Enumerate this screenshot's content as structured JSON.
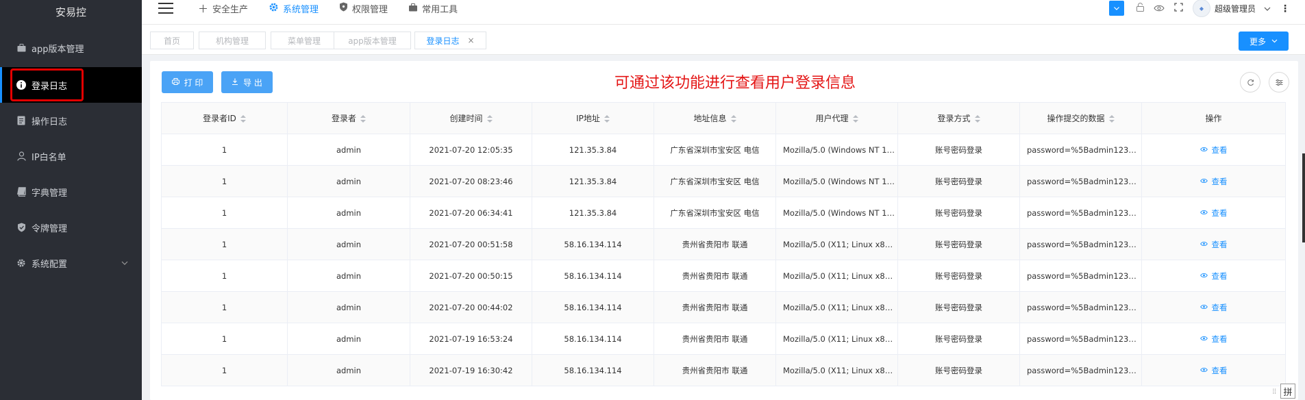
{
  "app": {
    "brand": "安易控"
  },
  "sidebar": {
    "items": [
      {
        "label": "app版本管理",
        "icon": "briefcase-icon"
      },
      {
        "label": "登录日志",
        "icon": "info-icon",
        "active": true
      },
      {
        "label": "操作日志",
        "icon": "document-icon"
      },
      {
        "label": "IP白名单",
        "icon": "user-icon"
      },
      {
        "label": "字典管理",
        "icon": "book-icon"
      },
      {
        "label": "令牌管理",
        "icon": "shield-icon"
      },
      {
        "label": "系统配置",
        "icon": "gear-icon",
        "expandable": true
      }
    ]
  },
  "header": {
    "nav": [
      {
        "label": "安全生产",
        "icon": "plus-icon"
      },
      {
        "label": "系统管理",
        "icon": "gear-icon",
        "active": true
      },
      {
        "label": "权限管理",
        "icon": "shield-icon"
      },
      {
        "label": "常用工具",
        "icon": "briefcase-icon"
      }
    ],
    "user_name": "超级管理员"
  },
  "tabs": [
    {
      "label": "首页"
    },
    {
      "label": "机构管理"
    },
    {
      "label": "菜单管理"
    },
    {
      "label": "app版本管理"
    },
    {
      "label": "登录日志",
      "active": true
    }
  ],
  "more_button": "更多",
  "toolbar": {
    "print": "打 印",
    "export": "导 出"
  },
  "notice": "可通过该功能进行查看用户登录信息",
  "table": {
    "columns": [
      "登录者ID",
      "登录者",
      "创建时间",
      "IP地址",
      "地址信息",
      "用户代理",
      "登录方式",
      "操作提交的数据",
      "操作"
    ],
    "rows": [
      [
        "1",
        "admin",
        "2021-07-20 12:05:35",
        "121.35.3.84",
        "广东省深圳市宝安区 电信",
        "Mozilla/5.0 (Windows NT 10....",
        "账号密码登录",
        "password=%5Badmin123%5..."
      ],
      [
        "1",
        "admin",
        "2021-07-20 08:23:46",
        "121.35.3.84",
        "广东省深圳市宝安区 电信",
        "Mozilla/5.0 (Windows NT 10....",
        "账号密码登录",
        "password=%5Badmin123%5..."
      ],
      [
        "1",
        "admin",
        "2021-07-20 06:34:41",
        "121.35.3.84",
        "广东省深圳市宝安区 电信",
        "Mozilla/5.0 (Windows NT 10....",
        "账号密码登录",
        "password=%5Badmin123%5..."
      ],
      [
        "1",
        "admin",
        "2021-07-20 00:51:58",
        "58.16.134.114",
        "贵州省贵阳市 联通",
        "Mozilla/5.0 (X11; Linux x86_...",
        "账号密码登录",
        "password=%5Badmin123%5..."
      ],
      [
        "1",
        "admin",
        "2021-07-20 00:50:15",
        "58.16.134.114",
        "贵州省贵阳市 联通",
        "Mozilla/5.0 (X11; Linux x86_...",
        "账号密码登录",
        "password=%5Badmin123%5..."
      ],
      [
        "1",
        "admin",
        "2021-07-20 00:44:02",
        "58.16.134.114",
        "贵州省贵阳市 联通",
        "Mozilla/5.0 (X11; Linux x86_...",
        "账号密码登录",
        "password=%5Badmin123%5..."
      ],
      [
        "1",
        "admin",
        "2021-07-19 16:53:24",
        "58.16.134.114",
        "贵州省贵阳市 联通",
        "Mozilla/5.0 (X11; Linux x86_...",
        "账号密码登录",
        "password=%5Badmin123%5..."
      ],
      [
        "1",
        "admin",
        "2021-07-19 16:30:42",
        "58.16.134.114",
        "贵州省贵阳市 联通",
        "Mozilla/5.0 (X11; Linux x86_...",
        "账号密码登录",
        "password=%5Badmin123%5..."
      ]
    ],
    "action_label": "查看"
  },
  "ime_label": "拼",
  "colors": {
    "accent": "#1890ff",
    "sidebar_bg": "#2b2e35",
    "highlight": "#e30000"
  }
}
